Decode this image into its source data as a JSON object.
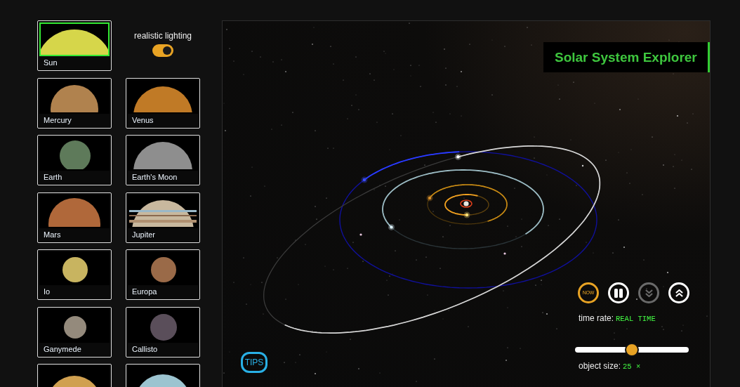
{
  "objects": [
    {
      "name": "Sun",
      "selected": true
    },
    {
      "name": "Mercury",
      "selected": false
    },
    {
      "name": "Venus",
      "selected": false
    },
    {
      "name": "Earth",
      "selected": false
    },
    {
      "name": "Earth's Moon",
      "selected": false
    },
    {
      "name": "Mars",
      "selected": false
    },
    {
      "name": "Jupiter",
      "selected": false
    },
    {
      "name": "Io",
      "selected": false
    },
    {
      "name": "Europa",
      "selected": false
    },
    {
      "name": "Ganymede",
      "selected": false
    },
    {
      "name": "Callisto",
      "selected": false
    },
    {
      "selected": false
    },
    {
      "selected": false
    }
  ],
  "lighting": {
    "label": "realistic lighting",
    "on": true
  },
  "title": "Solar System Explorer",
  "time_controls": [
    {
      "kind": "now",
      "label": "NOW",
      "disabled": false
    },
    {
      "kind": "pause",
      "disabled": false
    },
    {
      "kind": "slower",
      "disabled": true
    },
    {
      "kind": "faster",
      "disabled": false
    }
  ],
  "time_rate": {
    "label": "time rate:",
    "value": "REAL TIME"
  },
  "object_size": {
    "level": 0.5,
    "label": "object size:",
    "value": "25 ×"
  },
  "tips": {
    "label": "TIPS"
  }
}
